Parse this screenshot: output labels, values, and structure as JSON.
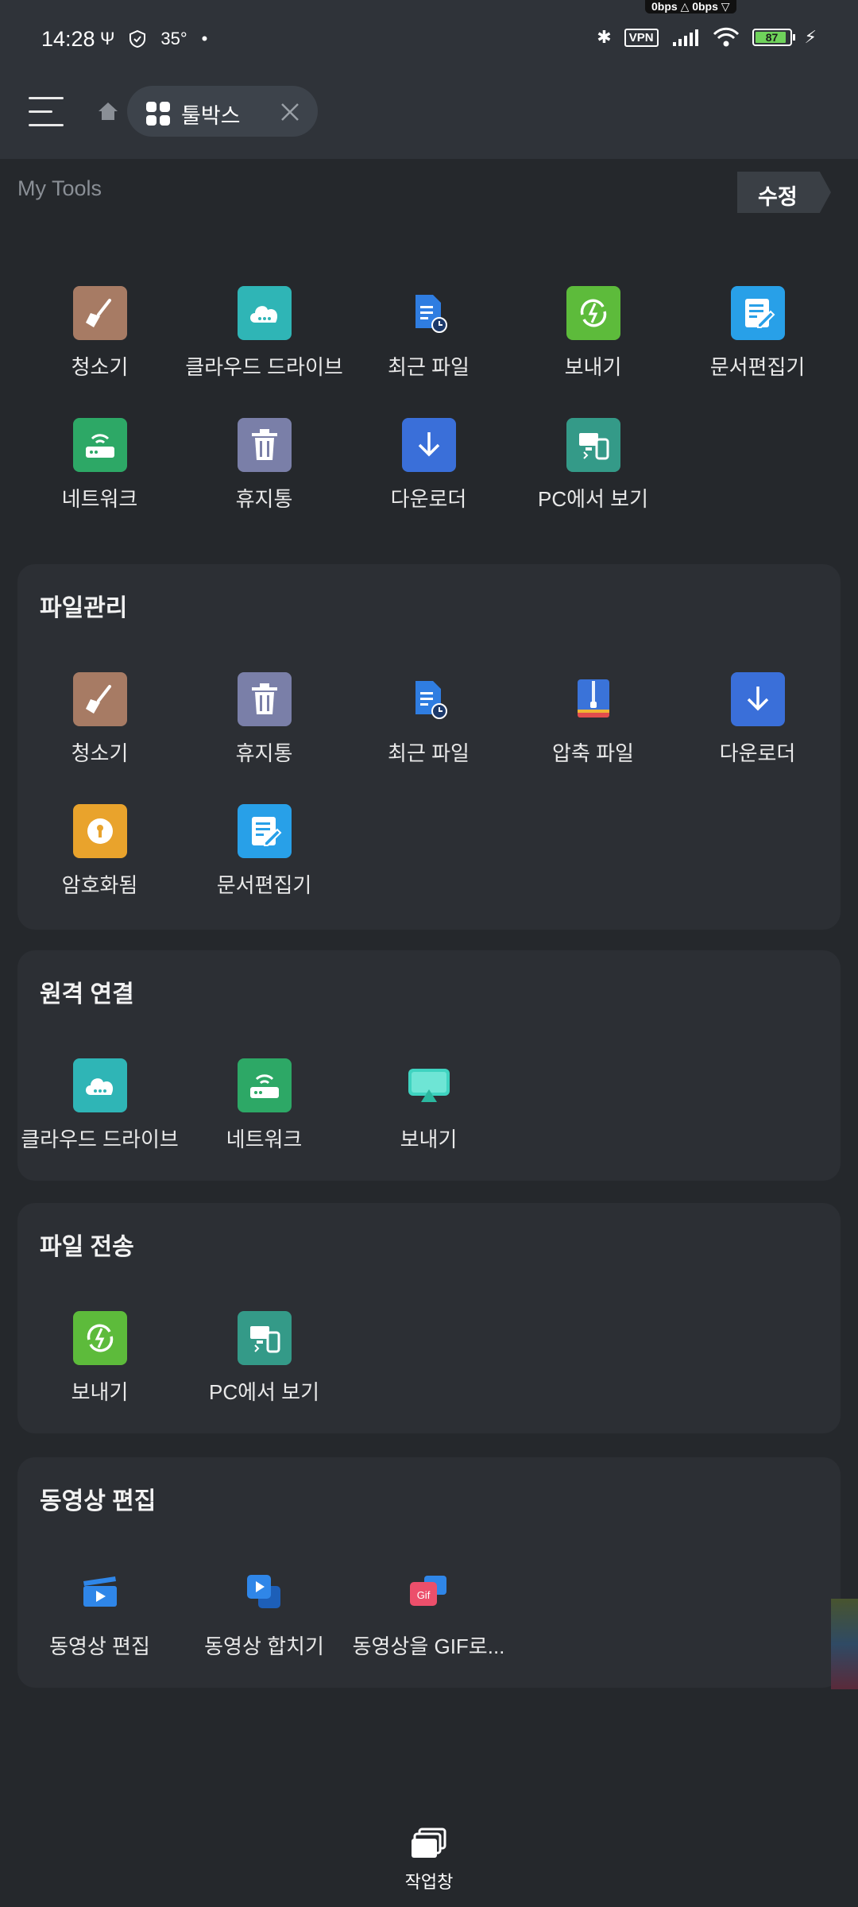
{
  "status_bar": {
    "time": "14:28",
    "temperature": "35°",
    "net_speed": "0bps △  0bps ▽",
    "vpn": "VPN",
    "battery": "87"
  },
  "top_bar": {
    "tab_label": "툴박스"
  },
  "my_tools": {
    "title": "My Tools",
    "edit_label": "수정",
    "items": [
      {
        "label": "청소기",
        "icon": "broom-icon",
        "color": "#a77b64"
      },
      {
        "label": "클라우드 드라이브",
        "icon": "cloud-icon",
        "color": "#2fb5b6"
      },
      {
        "label": "최근 파일",
        "icon": "recent-file-icon",
        "color": "#2f7de1"
      },
      {
        "label": "보내기",
        "icon": "send-icon",
        "color": "#5dbb3b"
      },
      {
        "label": "문서편집기",
        "icon": "document-editor-icon",
        "color": "#28a0e8"
      },
      {
        "label": "네트워크",
        "icon": "network-icon",
        "color": "#2da866"
      },
      {
        "label": "휴지통",
        "icon": "trash-icon",
        "color": "#7a7fa8"
      },
      {
        "label": "다운로더",
        "icon": "download-icon",
        "color": "#3a6fd9"
      },
      {
        "label": "PC에서 보기",
        "icon": "pc-view-icon",
        "color": "#349a88"
      }
    ]
  },
  "sections": [
    {
      "title": "파일관리",
      "items": [
        {
          "label": "청소기",
          "icon": "broom-icon",
          "color": "#a77b64"
        },
        {
          "label": "휴지통",
          "icon": "trash-icon",
          "color": "#7a7fa8"
        },
        {
          "label": "최근 파일",
          "icon": "recent-file-icon",
          "color": "#2f7de1"
        },
        {
          "label": "압축 파일",
          "icon": "zip-icon",
          "color": "#3a73d9"
        },
        {
          "label": "다운로더",
          "icon": "download-icon",
          "color": "#3a6fd9"
        },
        {
          "label": "암호화됨",
          "icon": "lock-icon",
          "color": "#e9a32c"
        },
        {
          "label": "문서편집기",
          "icon": "document-editor-icon",
          "color": "#28a0e8"
        }
      ]
    },
    {
      "title": "원격 연결",
      "items": [
        {
          "label": "클라우드 드라이브",
          "icon": "cloud-icon",
          "color": "#2fb5b6"
        },
        {
          "label": "네트워크",
          "icon": "network-icon",
          "color": "#2da866"
        },
        {
          "label": "보내기",
          "icon": "cast-icon",
          "color": "#3fd3c0"
        }
      ]
    },
    {
      "title": "파일 전송",
      "items": [
        {
          "label": "보내기",
          "icon": "send-icon",
          "color": "#5dbb3b"
        },
        {
          "label": "PC에서 보기",
          "icon": "pc-view-icon",
          "color": "#349a88"
        }
      ]
    },
    {
      "title": "동영상 편집",
      "items": [
        {
          "label": "동영상 편집",
          "icon": "video-edit-icon",
          "color": "#2f86e8"
        },
        {
          "label": "동영상 합치기",
          "icon": "video-merge-icon",
          "color": "#2f86e8"
        },
        {
          "label": "동영상을 GIF로...",
          "icon": "gif-icon",
          "color": "#ec4f6b"
        }
      ]
    }
  ],
  "bottom": {
    "task_label": "작업창"
  }
}
